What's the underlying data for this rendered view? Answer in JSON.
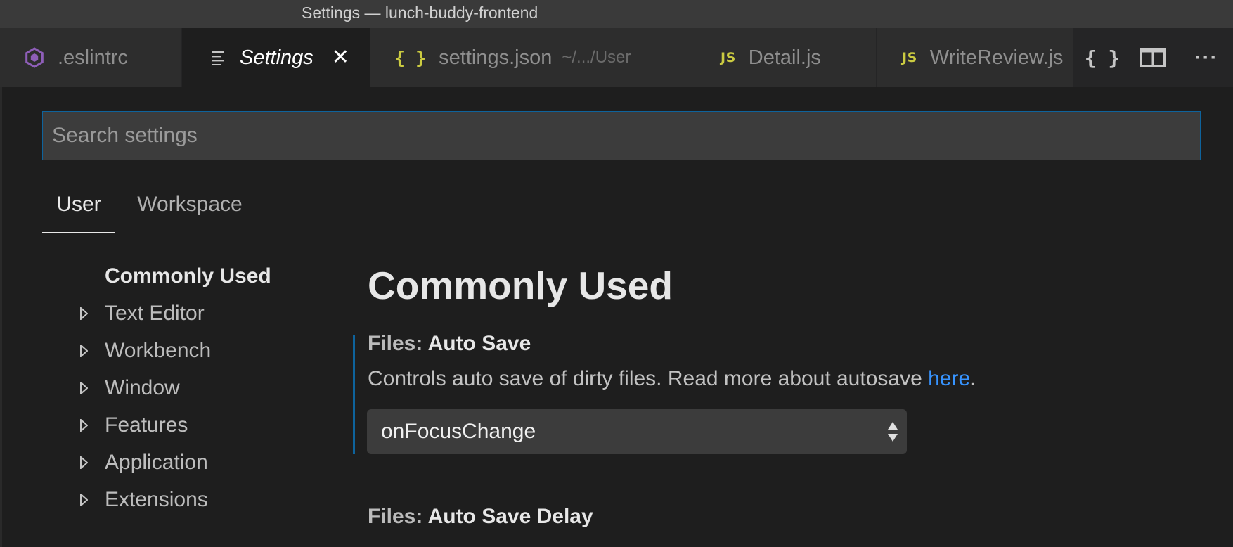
{
  "window": {
    "title": "Settings — lunch-buddy-frontend"
  },
  "tabs": [
    {
      "label": ".eslintrc",
      "icon": "eslint-icon",
      "active": false
    },
    {
      "label": "Settings",
      "icon": "settings-list-icon",
      "active": true,
      "close": "✕"
    },
    {
      "label": "settings.json",
      "sub": "~/.../User",
      "icon": "json-braces-icon",
      "active": false
    },
    {
      "label": "Detail.js",
      "icon": "js-file-icon",
      "active": false
    },
    {
      "label": "WriteReview.js",
      "icon": "js-file-icon",
      "active": false
    }
  ],
  "tab_icons": {
    "js": "JS",
    "json": "{ }"
  },
  "editor_actions": {
    "open_json": "{ }",
    "more": "···"
  },
  "search": {
    "placeholder": "Search settings",
    "value": ""
  },
  "scope_tabs": {
    "user": "User",
    "workspace": "Workspace"
  },
  "toc": [
    {
      "label": "Commonly Used",
      "selected": true,
      "expandable": false
    },
    {
      "label": "Text Editor",
      "selected": false,
      "expandable": true
    },
    {
      "label": "Workbench",
      "selected": false,
      "expandable": true
    },
    {
      "label": "Window",
      "selected": false,
      "expandable": true
    },
    {
      "label": "Features",
      "selected": false,
      "expandable": true
    },
    {
      "label": "Application",
      "selected": false,
      "expandable": true
    },
    {
      "label": "Extensions",
      "selected": false,
      "expandable": true
    }
  ],
  "main": {
    "section_title": "Commonly Used",
    "settings": [
      {
        "category": "Files: ",
        "name": "Auto Save",
        "description": "Controls auto save of dirty files. Read more about autosave ",
        "link": "here",
        "description_end": ".",
        "value": "onFocusChange"
      },
      {
        "category": "Files: ",
        "name": "Auto Save Delay"
      }
    ]
  },
  "colors": {
    "accent": "#0e639c",
    "link": "#3794ff",
    "js_icon": "#cbcb41",
    "eslint_icon": "#8e5eb8"
  }
}
